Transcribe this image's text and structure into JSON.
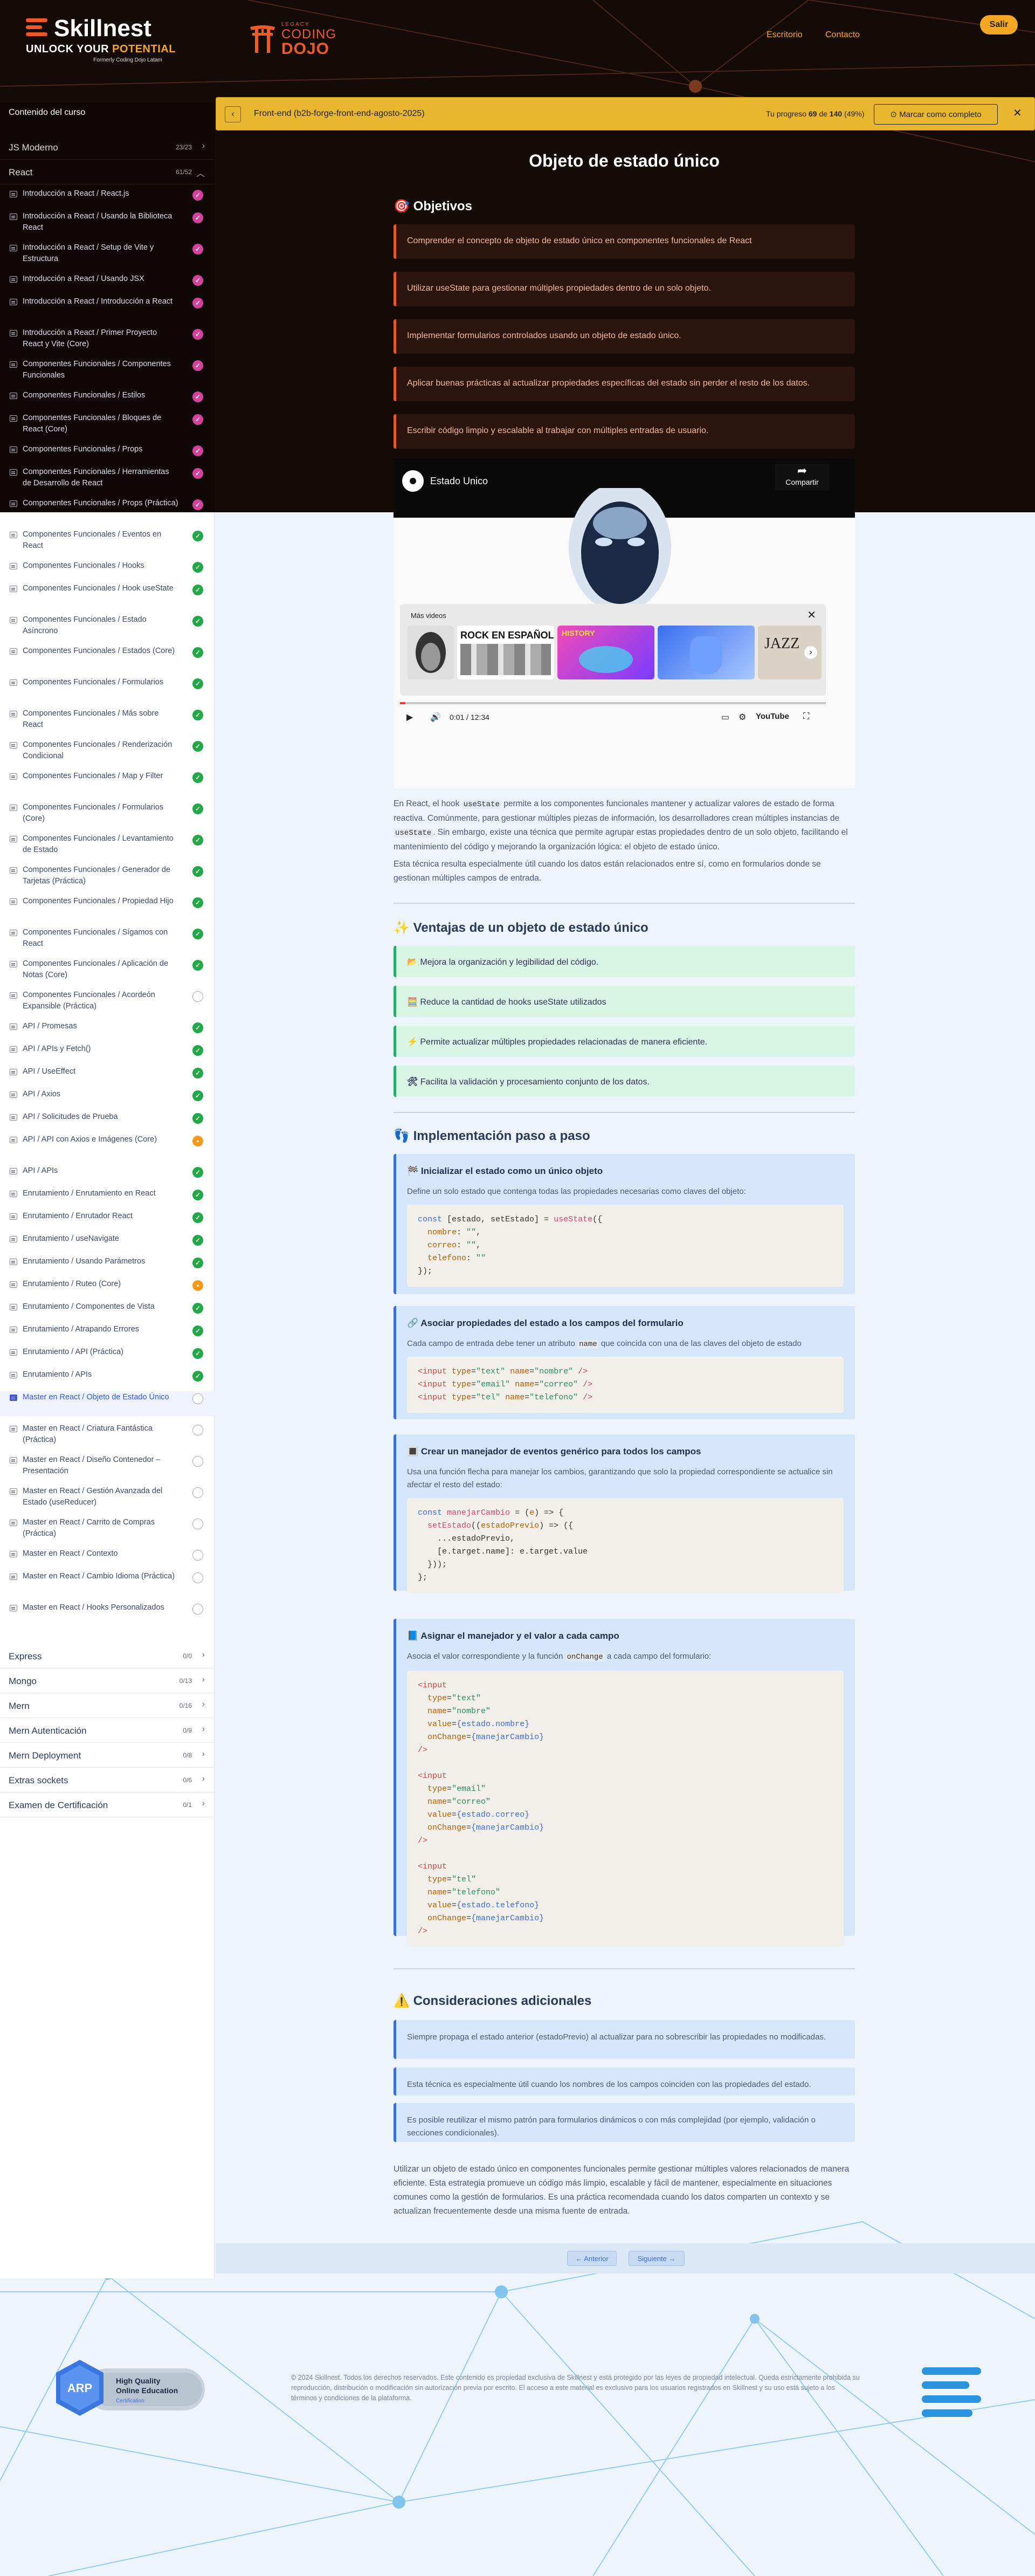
{
  "header": {
    "logo_name": "Skillnest",
    "logo_tag_a": "UNLOCK YOUR ",
    "logo_tag_b": "POTENTIAL",
    "logo_tag_c": "Formerly Coding Dojo Latam",
    "partner_small": "LEGACY",
    "partner_l1": "CODING",
    "partner_l2": "DOJO",
    "nav": [
      "Escritorio",
      "Contacto"
    ],
    "logout": "Salir",
    "accent": "#f5a623"
  },
  "sidebar": {
    "title": "Contenido del curso",
    "modules_top": [
      {
        "name": "JS Moderno",
        "count": "23/23"
      },
      {
        "name": "React",
        "count": "61/52"
      }
    ],
    "lessons": [
      {
        "t": "Introducción a React / React.js",
        "s": "done"
      },
      {
        "t": "Introducción a React / Usando la Biblioteca React",
        "s": "done"
      },
      {
        "t": "Introducción a React / Setup de Vite y Estructura",
        "s": "done"
      },
      {
        "t": "Introducción a React / Usando JSX",
        "s": "done"
      },
      {
        "t": "Introducción a React / Introducción a React",
        "s": "done"
      },
      {
        "t": "Introducción a React / Primer Proyecto React y Vite (Core)",
        "s": "done"
      },
      {
        "t": "Componentes Funcionales / Componentes Funcionales",
        "s": "done"
      },
      {
        "t": "Componentes Funcionales / Estilos",
        "s": "done"
      },
      {
        "t": "Componentes Funcionales / Bloques de React (Core)",
        "s": "done"
      },
      {
        "t": "Componentes Funcionales / Props",
        "s": "done"
      },
      {
        "t": "Componentes Funcionales / Herramientas de Desarrollo de React",
        "s": "done"
      },
      {
        "t": "Componentes Funcionales / Props (Práctica)",
        "s": "done"
      },
      {
        "t": "Componentes Funcionales / Eventos en React",
        "s": "done"
      },
      {
        "t": "Componentes Funcionales / Hooks",
        "s": "done"
      },
      {
        "t": "Componentes Funcionales / Hook useState",
        "s": "done"
      },
      {
        "t": "Componentes Funcionales / Estado Asíncrono",
        "s": "done"
      },
      {
        "t": "Componentes Funcionales / Estados (Core)",
        "s": "done"
      },
      {
        "t": "Componentes Funcionales / Formularios",
        "s": "done"
      },
      {
        "t": "Componentes Funcionales / Más sobre React",
        "s": "done"
      },
      {
        "t": "Componentes Funcionales / Renderización Condicional",
        "s": "done"
      },
      {
        "t": "Componentes Funcionales / Map y Filter",
        "s": "done"
      },
      {
        "t": "Componentes Funcionales / Formularios (Core)",
        "s": "done"
      },
      {
        "t": "Componentes Funcionales / Levantamiento de Estado",
        "s": "done"
      },
      {
        "t": "Componentes Funcionales / Generador de Tarjetas (Práctica)",
        "s": "done"
      },
      {
        "t": "Componentes Funcionales / Propiedad Hijo",
        "s": "done"
      },
      {
        "t": "Componentes Funcionales / Sígamos con React",
        "s": "done"
      },
      {
        "t": "Componentes Funcionales / Aplicación de Notas (Core)",
        "s": "done"
      },
      {
        "t": "Componentes Funcionales / Acordeón Expansible (Práctica)",
        "s": "pend"
      },
      {
        "t": "API / Promesas",
        "s": "done"
      },
      {
        "t": "API / APIs y Fetch()",
        "s": "done"
      },
      {
        "t": "API / UseEffect",
        "s": "done"
      },
      {
        "t": "API / Axios",
        "s": "done"
      },
      {
        "t": "API / Solicitudes de Prueba",
        "s": "done"
      },
      {
        "t": "API / API con Axios e Imágenes (Core)",
        "s": "part"
      },
      {
        "t": "API / APIs",
        "s": "done"
      },
      {
        "t": "Enrutamiento / Enrutamiento en React",
        "s": "done"
      },
      {
        "t": "Enrutamiento / Enrutador React",
        "s": "done"
      },
      {
        "t": "Enrutamiento / useNavigate",
        "s": "done"
      },
      {
        "t": "Enrutamiento / Usando Parámetros",
        "s": "done"
      },
      {
        "t": "Enrutamiento / Ruteo (Core)",
        "s": "part"
      },
      {
        "t": "Enrutamiento / Componentes de Vista",
        "s": "done"
      },
      {
        "t": "Enrutamiento / Atrapando Errores",
        "s": "done"
      },
      {
        "t": "Enrutamiento / API (Práctica)",
        "s": "done"
      },
      {
        "t": "Enrutamiento / APIs",
        "s": "done"
      },
      {
        "t": "Master en React / Objeto de Estado Único",
        "s": "pend",
        "current": true
      },
      {
        "t": "Master en React / Criatura Fantástica (Práctica)",
        "s": "pend"
      },
      {
        "t": "Master en React / Diseño Contenedor – Presentación",
        "s": "pend"
      },
      {
        "t": "Master en React / Gestión Avanzada del Estado (useReducer)",
        "s": "pend"
      },
      {
        "t": "Master en React / Carrito de Compras (Práctica)",
        "s": "pend"
      },
      {
        "t": "Master en React / Contexto",
        "s": "pend"
      },
      {
        "t": "Master en React / Cambio Idioma (Práctica)",
        "s": "pend"
      },
      {
        "t": "Master en React / Hooks Personalizados",
        "s": "pend"
      }
    ],
    "modules_bottom": [
      {
        "name": "Express",
        "count": "0/0"
      },
      {
        "name": "Mongo",
        "count": "0/13"
      },
      {
        "name": "Mern",
        "count": "0/16"
      },
      {
        "name": "Mern Autenticación",
        "count": "0/9"
      },
      {
        "name": "Mern Deployment",
        "count": "0/8"
      },
      {
        "name": "Extras sockets",
        "count": "0/6"
      },
      {
        "name": "Examen de Certificación",
        "count": "0/1"
      }
    ]
  },
  "lesson_bar": {
    "back": "‹",
    "title": "Front-end (b2b-forge-front-end-agosto-2025)",
    "progress_a": "Tu progreso ",
    "progress_b": "69",
    "progress_c": " de ",
    "progress_d": "140",
    "progress_e": " (49%)",
    "mark_complete": "Marcar como completo",
    "close": "✕"
  },
  "content": {
    "title": "Objeto de estado único",
    "objectives_h": "Objetivos",
    "objectives": [
      "Comprender el concepto de objeto de estado único en componentes funcionales de React",
      "Utilizar useState para gestionar múltiples propiedades dentro de un solo objeto.",
      "Implementar formularios controlados usando un objeto de estado único.",
      "Aplicar buenas prácticas al actualizar propiedades específicas del estado sin perder el resto de los datos.",
      "Escribir código limpio y escalable al trabajar con múltiples entradas de usuario."
    ],
    "video": {
      "title": "Estado Unico",
      "share": "Compartir",
      "more": "Más videos",
      "close": "✕",
      "time": "0:01 / 12:34",
      "brand": "YouTube",
      "thumb1": "ROCK EN ESPAÑOL",
      "thumb2": "HISTORY",
      "thumb4": "JAZZ"
    },
    "intro_a": "En React, el hook ",
    "intro_code1": "useState",
    "intro_b": " permite a los componentes funcionales mantener y actualizar valores de estado de forma reactiva. Comúnmente, para gestionar múltiples piezas de información, los desarrolladores crean múltiples instancias de ",
    "intro_code2": "useState",
    "intro_c": ". Sin embargo, existe una técnica que permite agrupar estas propiedades dentro de un solo objeto, facilitando el mantenimiento del código y mejorando la organización lógica: el objeto de estado único.",
    "intro2": "Esta técnica resulta especialmente útil cuando los datos están relacionados entre sí, como en formularios donde se gestionan múltiples campos de entrada.",
    "advantages_h": "Ventajas de un objeto de estado único",
    "advantages": [
      {
        "icon": "📂",
        "text": "Mejora la organización y legibilidad del código."
      },
      {
        "icon": "🧮",
        "text": "Reduce la cantidad de hooks useState utilizados"
      },
      {
        "icon": "⚡",
        "text": "Permite actualizar múltiples propiedades relacionadas de manera eficiente."
      },
      {
        "icon": "🛠",
        "text": "Facilita la validación y procesamiento conjunto de los datos."
      }
    ],
    "impl_h": "Implementación paso a paso",
    "steps": [
      {
        "icon": "🏁",
        "h": "Inicializar el estado como un único objeto",
        "d": "Define un solo estado que contenga todas las propiedades necesarias como claves del objeto:"
      },
      {
        "icon": "🔗",
        "h": "Asociar propiedades del estado a los campos del formulario",
        "d_a": "Cada campo de entrada debe tener un atributo ",
        "d_code": "name",
        "d_b": " que coincida con una de las claves del objeto de estado"
      },
      {
        "icon": "🔳",
        "h": "Crear un manejador de eventos genérico para todos los campos",
        "d": "Usa una función flecha para manejar los cambios, garantizando que solo la propiedad correspondiente se actualice sin afectar el resto del estado:"
      },
      {
        "icon": "📘",
        "h": "Asignar el manejador y el valor a cada campo",
        "d_a": "Asocia el valor correspondiente y la función ",
        "d_code": "onChange",
        "d_b": " a cada campo del formulario:"
      }
    ],
    "considerations_h": "Consideraciones adicionales",
    "considerations": [
      "Siempre propaga el estado anterior (estadoPrevio) al actualizar para no sobrescribir las propiedades no modificadas.",
      "Esta técnica es especialmente útil cuando los nombres de los campos coinciden con las propiedades del estado.",
      "Es posible reutilizar el mismo patrón para formularios dinámicos o con más complejidad (por ejemplo, validación o secciones condicionales)."
    ],
    "conclusion": "Utilizar un objeto de estado único en componentes funcionales permite gestionar múltiples valores relacionados de manera eficiente. Esta estrategia promueve un código más limpio, escalable y fácil de mantener, especialmente en situaciones comunes como la gestión de formularios. Es una práctica recomendada cuando los datos comparten un contexto y se actualizan frecuentemente desde una misma fuente de entrada."
  },
  "pager": {
    "prev": "← Anterior",
    "next": "Siguiente →"
  },
  "footer": {
    "badge_l1": "High Quality",
    "badge_l2": "Online Education",
    "badge_l3": "Certification",
    "badge_mark": "ARP",
    "text": "© 2024 Skillnest. Todos los derechos reservados. Este contenido es propiedad exclusiva de Skillnest y está protegido por las leyes de propiedad intelectual. Queda estrictamente prohibida su reproducción, distribución o modificación sin autorización previa por escrito. El acceso a este material es exclusivo para los usuarios registrados en Skillnest y su uso está sujeto a los términos y condiciones de la plataforma."
  }
}
